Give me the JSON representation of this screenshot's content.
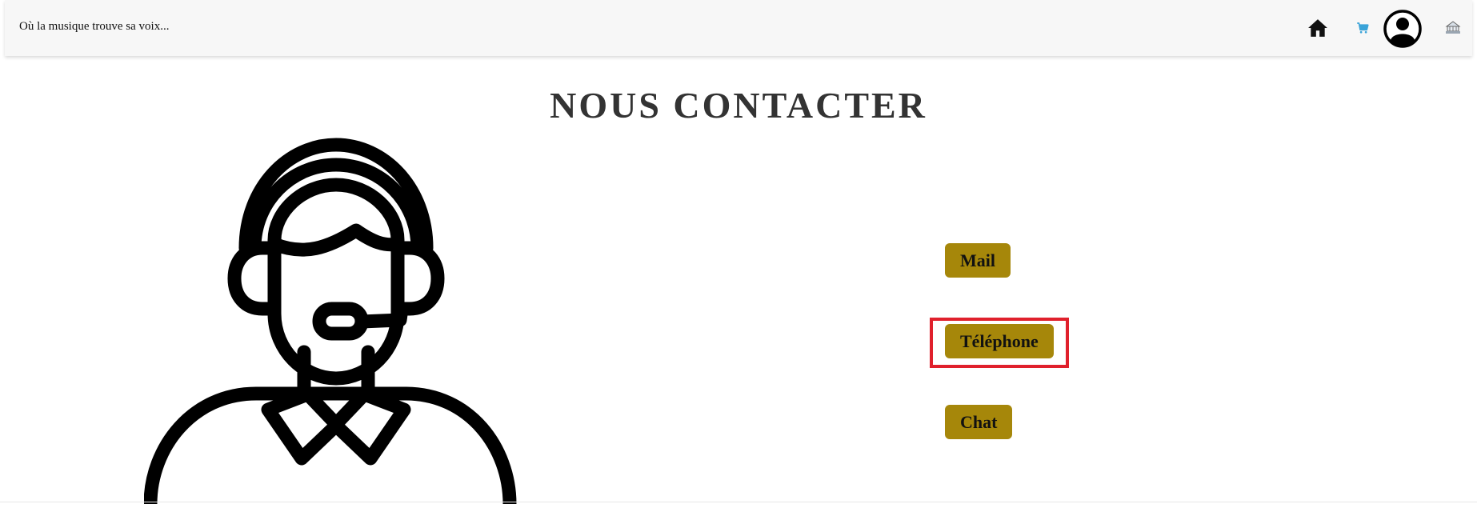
{
  "navbar": {
    "tagline": "Où la musique trouve sa voix...",
    "icons": [
      "home-icon",
      "cart-icon",
      "user-account-icon",
      "admin-icon"
    ],
    "colors": {
      "background": "#f7f7f7",
      "cart": "#3aa3d8"
    }
  },
  "main": {
    "title": "NOUS CONTACTER",
    "illustration": "customer-support-agent-headset",
    "buttons": {
      "mail": "Mail",
      "telephone": "Téléphone",
      "chat": "Chat"
    },
    "button_color": "#a6870a",
    "highlighted_button": "telephone",
    "highlight_color": "#e0202c"
  }
}
